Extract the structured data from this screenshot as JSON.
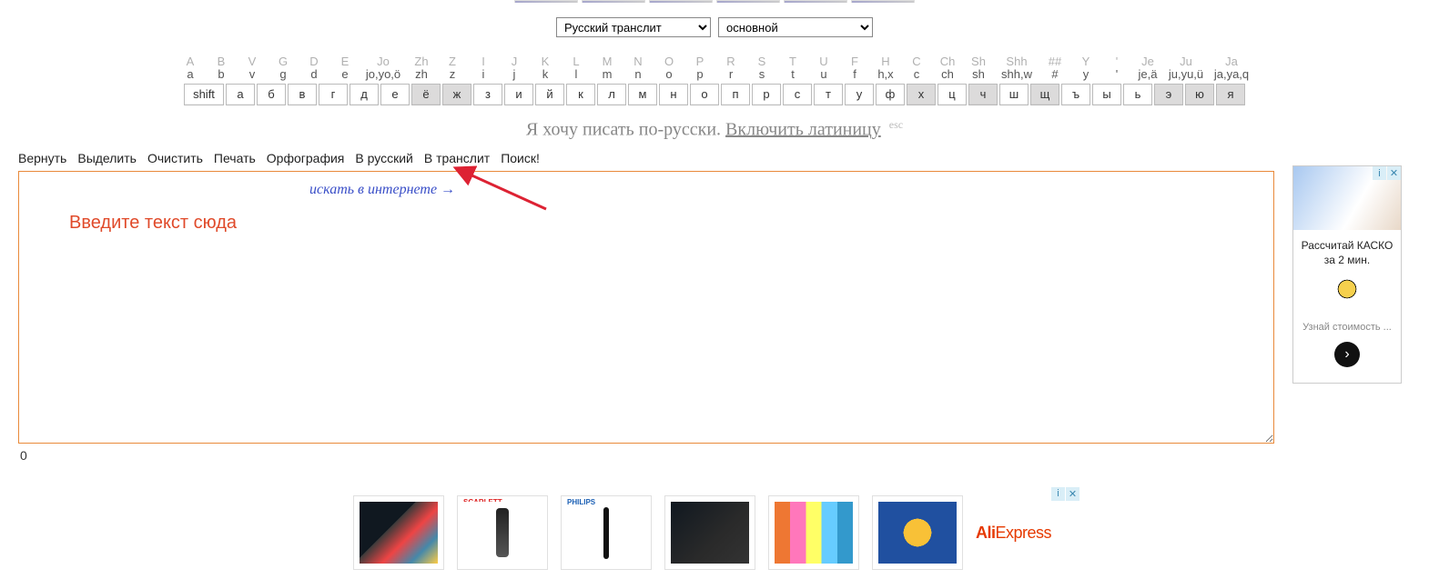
{
  "selects": {
    "layout": {
      "selected": "Русский транслит"
    },
    "mode": {
      "selected": "основной"
    }
  },
  "keyboard": {
    "heads": [
      {
        "top": "A",
        "bot": "a",
        "w": false
      },
      {
        "top": "B",
        "bot": "b",
        "w": false
      },
      {
        "top": "V",
        "bot": "v",
        "w": false
      },
      {
        "top": "G",
        "bot": "g",
        "w": false
      },
      {
        "top": "D",
        "bot": "d",
        "w": false
      },
      {
        "top": "E",
        "bot": "e",
        "w": false
      },
      {
        "top": "Jo",
        "bot": "jo,yo,ö",
        "w": true
      },
      {
        "top": "Zh",
        "bot": "zh",
        "w": false
      },
      {
        "top": "Z",
        "bot": "z",
        "w": false
      },
      {
        "top": "I",
        "bot": "i",
        "w": false
      },
      {
        "top": "J",
        "bot": "j",
        "w": false
      },
      {
        "top": "K",
        "bot": "k",
        "w": false
      },
      {
        "top": "L",
        "bot": "l",
        "w": false
      },
      {
        "top": "M",
        "bot": "m",
        "w": false
      },
      {
        "top": "N",
        "bot": "n",
        "w": false
      },
      {
        "top": "O",
        "bot": "o",
        "w": false
      },
      {
        "top": "P",
        "bot": "p",
        "w": false
      },
      {
        "top": "R",
        "bot": "r",
        "w": false
      },
      {
        "top": "S",
        "bot": "s",
        "w": false
      },
      {
        "top": "T",
        "bot": "t",
        "w": false
      },
      {
        "top": "U",
        "bot": "u",
        "w": false
      },
      {
        "top": "F",
        "bot": "f",
        "w": false
      },
      {
        "top": "H",
        "bot": "h,x",
        "w": false
      },
      {
        "top": "C",
        "bot": "c",
        "w": false
      },
      {
        "top": "Ch",
        "bot": "ch",
        "w": false
      },
      {
        "top": "Sh",
        "bot": "sh",
        "w": false
      },
      {
        "top": "Shh",
        "bot": "shh,w",
        "w": true
      },
      {
        "top": "##",
        "bot": "#",
        "w": false
      },
      {
        "top": "Y",
        "bot": "y",
        "w": false
      },
      {
        "top": "'",
        "bot": "'",
        "w": false
      },
      {
        "top": "Je",
        "bot": "je,ä",
        "w": false
      },
      {
        "top": "Ju",
        "bot": "ju,yu,ü",
        "w": true
      },
      {
        "top": "Ja",
        "bot": "ja,ya,q",
        "w": true
      }
    ],
    "shift_label": "shift",
    "keys": [
      {
        "l": "а",
        "hl": false
      },
      {
        "l": "б",
        "hl": false
      },
      {
        "l": "в",
        "hl": false
      },
      {
        "l": "г",
        "hl": false
      },
      {
        "l": "д",
        "hl": false
      },
      {
        "l": "е",
        "hl": false
      },
      {
        "l": "ё",
        "hl": true
      },
      {
        "l": "ж",
        "hl": true
      },
      {
        "l": "з",
        "hl": false
      },
      {
        "l": "и",
        "hl": false
      },
      {
        "l": "й",
        "hl": false
      },
      {
        "l": "к",
        "hl": false
      },
      {
        "l": "л",
        "hl": false
      },
      {
        "l": "м",
        "hl": false
      },
      {
        "l": "н",
        "hl": false
      },
      {
        "l": "о",
        "hl": false
      },
      {
        "l": "п",
        "hl": false
      },
      {
        "l": "р",
        "hl": false
      },
      {
        "l": "с",
        "hl": false
      },
      {
        "l": "т",
        "hl": false
      },
      {
        "l": "у",
        "hl": false
      },
      {
        "l": "ф",
        "hl": false
      },
      {
        "l": "х",
        "hl": true
      },
      {
        "l": "ц",
        "hl": false
      },
      {
        "l": "ч",
        "hl": true
      },
      {
        "l": "ш",
        "hl": false
      },
      {
        "l": "щ",
        "hl": true
      },
      {
        "l": "ъ",
        "hl": false
      },
      {
        "l": "ы",
        "hl": false
      },
      {
        "l": "ь",
        "hl": false
      },
      {
        "l": "э",
        "hl": true
      },
      {
        "l": "ю",
        "hl": true
      },
      {
        "l": "я",
        "hl": true
      }
    ]
  },
  "hint": {
    "prefix": "Я хочу писать по-русски. ",
    "link": "Включить латиницу",
    "esc": "esc"
  },
  "toolbar": {
    "undo": "Вернуть",
    "select_all": "Выделить",
    "clear": "Очистить",
    "print": "Печать",
    "spell": "Орфография",
    "to_russian": "В русский",
    "to_translit": "В транслит",
    "search": "Поиск!"
  },
  "editor": {
    "placeholder": "Введите текст сюда",
    "hand_note": "искать в интернете",
    "counter": "0"
  },
  "side_ad": {
    "line1": "Рассчитай КАСКО",
    "line2": "за 2 мин.",
    "sub": "Узнай стоимость ..."
  },
  "bottom_ad": {
    "brand": "AliExpress",
    "tags": {
      "scarlett": "SCARLETT",
      "philips": "PHILIPS"
    }
  }
}
